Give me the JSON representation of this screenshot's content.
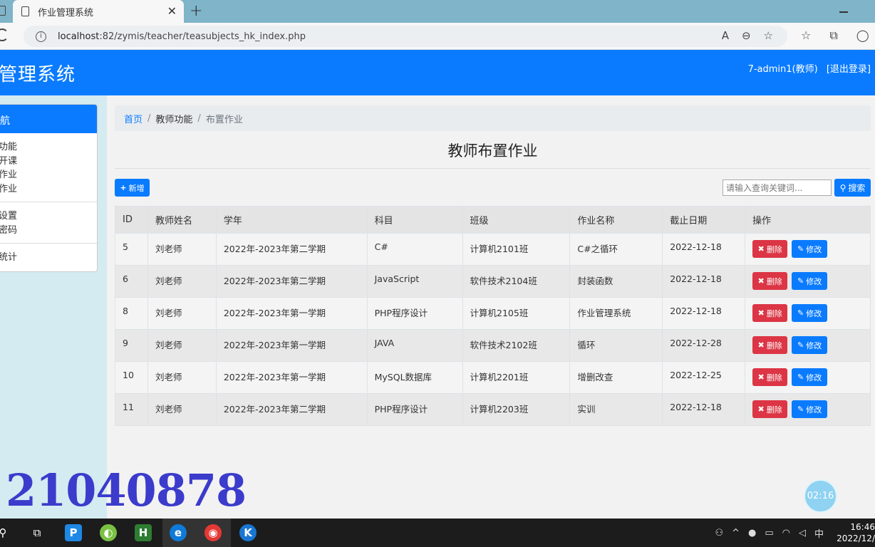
{
  "browser": {
    "tab_title": "作业管理系统",
    "tab_close": "✕",
    "new_tab": "+",
    "url_host": "localhost",
    "url_path": ":82/zymis/teacher/teasubjects_hk_index.php"
  },
  "header": {
    "title": "管理系统",
    "user": "7-admin1(教师)",
    "logout": "[退出登录]"
  },
  "sidebar": {
    "head": "航",
    "group1": [
      "功能",
      "开课",
      "作业",
      "作业"
    ],
    "group2": [
      "设置",
      "密码"
    ],
    "group3": [
      "统计"
    ]
  },
  "breadcrumb": {
    "home": "首页",
    "sep": "/",
    "mid": "教师功能",
    "current": "布置作业"
  },
  "page_title": "教师布置作业",
  "toolbar": {
    "add_label": "新增",
    "search_placeholder": "请输入查询关键词...",
    "search_label": "搜索"
  },
  "table": {
    "headers": [
      "ID",
      "教师姓名",
      "学年",
      "科目",
      "班级",
      "作业名称",
      "截止日期",
      "操作"
    ],
    "delete_label": "删除",
    "edit_label": "修改",
    "rows": [
      [
        "5",
        "刘老师",
        "2022年-2023年第二学期",
        "C#",
        "计算机2101班",
        "C#之循环",
        "2022-12-18"
      ],
      [
        "6",
        "刘老师",
        "2022年-2023年第二学期",
        "JavaScript",
        "软件技术2104班",
        "封装函数",
        "2022-12-18"
      ],
      [
        "8",
        "刘老师",
        "2022年-2023年第一学期",
        "PHP程序设计",
        "计算机2105班",
        "作业管理系统",
        "2022-12-18"
      ],
      [
        "9",
        "刘老师",
        "2022年-2023年第一学期",
        "JAVA",
        "软件技术2102班",
        "循环",
        "2022-12-28"
      ],
      [
        "10",
        "刘老师",
        "2022年-2023年第一学期",
        "MySQL数据库",
        "计算机2201班",
        "增删改查",
        "2022-12-25"
      ],
      [
        "11",
        "刘老师",
        "2022年-2023年第二学期",
        "PHP程序设计",
        "计算机2203班",
        "实训",
        "2022-12-18"
      ]
    ]
  },
  "overlay": {
    "watermark": "21040878",
    "timer": "02:16"
  },
  "taskbar": {
    "ime": "中",
    "time": "16:46",
    "date": "2022/12/"
  },
  "colors": {
    "primary": "#0a7bff",
    "danger": "#dc3545",
    "sidebar_bg": "#d4ebf1"
  }
}
